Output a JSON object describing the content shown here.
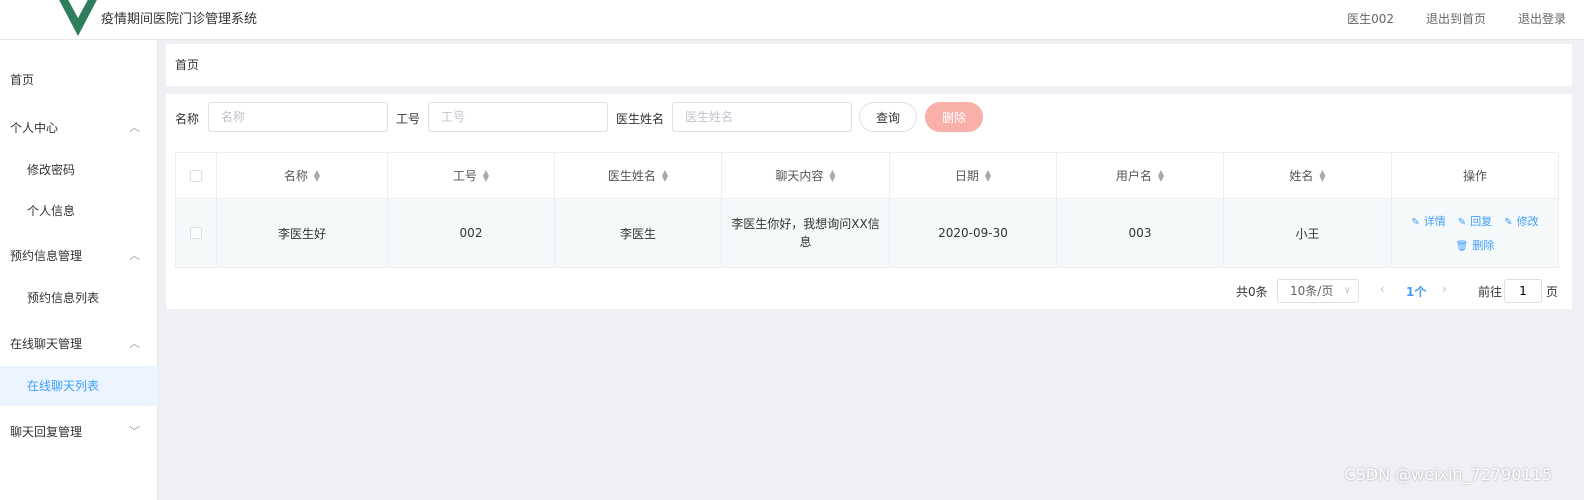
{
  "header": {
    "title": "疫情期间医院门诊管理系统",
    "user": "医生002",
    "exit_home": "退出到首页",
    "logout": "退出登录"
  },
  "sidebar": {
    "items": [
      {
        "label": "首页"
      },
      {
        "label": "个人中心"
      },
      {
        "label": "修改密码"
      },
      {
        "label": "个人信息"
      },
      {
        "label": "预约信息管理"
      },
      {
        "label": "预约信息列表"
      },
      {
        "label": "在线聊天管理"
      },
      {
        "label": "在线聊天列表"
      },
      {
        "label": "聊天回复管理"
      }
    ]
  },
  "breadcrumb": "首页",
  "search": {
    "name_label": "名称",
    "name_placeholder": "名称",
    "id_label": "工号",
    "id_placeholder": "工号",
    "doctor_label": "医生姓名",
    "doctor_placeholder": "医生姓名",
    "query_button": "查询",
    "delete_button": "删除"
  },
  "table": {
    "headers": [
      "名称",
      "工号",
      "医生姓名",
      "聊天内容",
      "日期",
      "用户名",
      "姓名",
      "操作"
    ],
    "rows": [
      {
        "name": "李医生好",
        "id": "002",
        "doctor": "李医生",
        "content": "李医生你好，我想询问XX信息",
        "date": "2020-09-30",
        "username": "003",
        "realname": "小王",
        "ops": {
          "detail": "详情",
          "reply": "回复",
          "edit": "修改",
          "delete": "删除"
        }
      }
    ]
  },
  "pagination": {
    "total": "共0条",
    "page_size": "10条/页",
    "current": "1个",
    "goto_label": "前往",
    "goto_value": "1",
    "page_label": "页"
  },
  "watermark": "CSDN @weixin_72790115",
  "colors": {
    "accent": "#409eff",
    "delete_button": "#f8b0a8",
    "logo_green": "#35495e",
    "logo_light": "#41b883"
  }
}
